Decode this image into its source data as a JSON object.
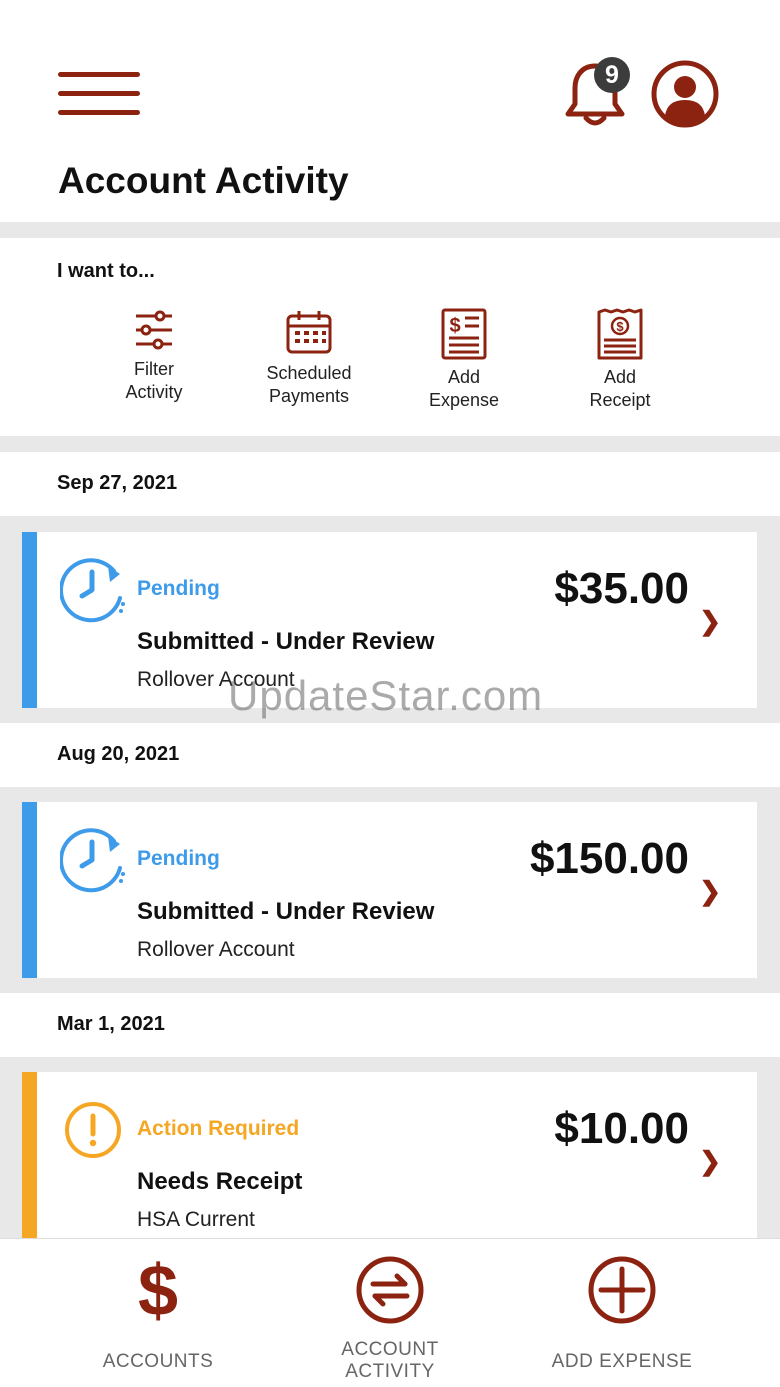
{
  "header": {
    "title": "Account Activity",
    "notification_count": "9"
  },
  "iwant": {
    "title": "I want to...",
    "actions": [
      {
        "label": "Filter Activity",
        "icon": "sliders-icon"
      },
      {
        "label": "Scheduled Payments",
        "icon": "calendar-icon"
      },
      {
        "label": "Add Expense",
        "icon": "expense-document-icon"
      },
      {
        "label": "Add Receipt",
        "icon": "receipt-icon"
      }
    ]
  },
  "activity": [
    {
      "date": "Sep 27, 2021",
      "status": "Pending",
      "status_color": "#3d9bea",
      "amount": "$35.00",
      "description": "Submitted - Under Review",
      "account": "Rollover Account"
    },
    {
      "date": "Aug 20, 2021",
      "status": "Pending",
      "status_color": "#3d9bea",
      "amount": "$150.00",
      "description": "Submitted - Under Review",
      "account": "Rollover Account"
    },
    {
      "date": "Mar 1, 2021",
      "status": "Action Required",
      "status_color": "#f5a623",
      "amount": "$10.00",
      "description": "Needs Receipt",
      "account": "HSA Current"
    }
  ],
  "watermark": "UpdateStar.com",
  "tabbar": {
    "accounts": "ACCOUNTS",
    "activity_line1": "ACCOUNT",
    "activity_line2": "ACTIVITY",
    "add_expense": "ADD EXPENSE"
  },
  "colors": {
    "brand": "#8b2310",
    "pending": "#3d9bea",
    "action_required": "#f5a623"
  }
}
